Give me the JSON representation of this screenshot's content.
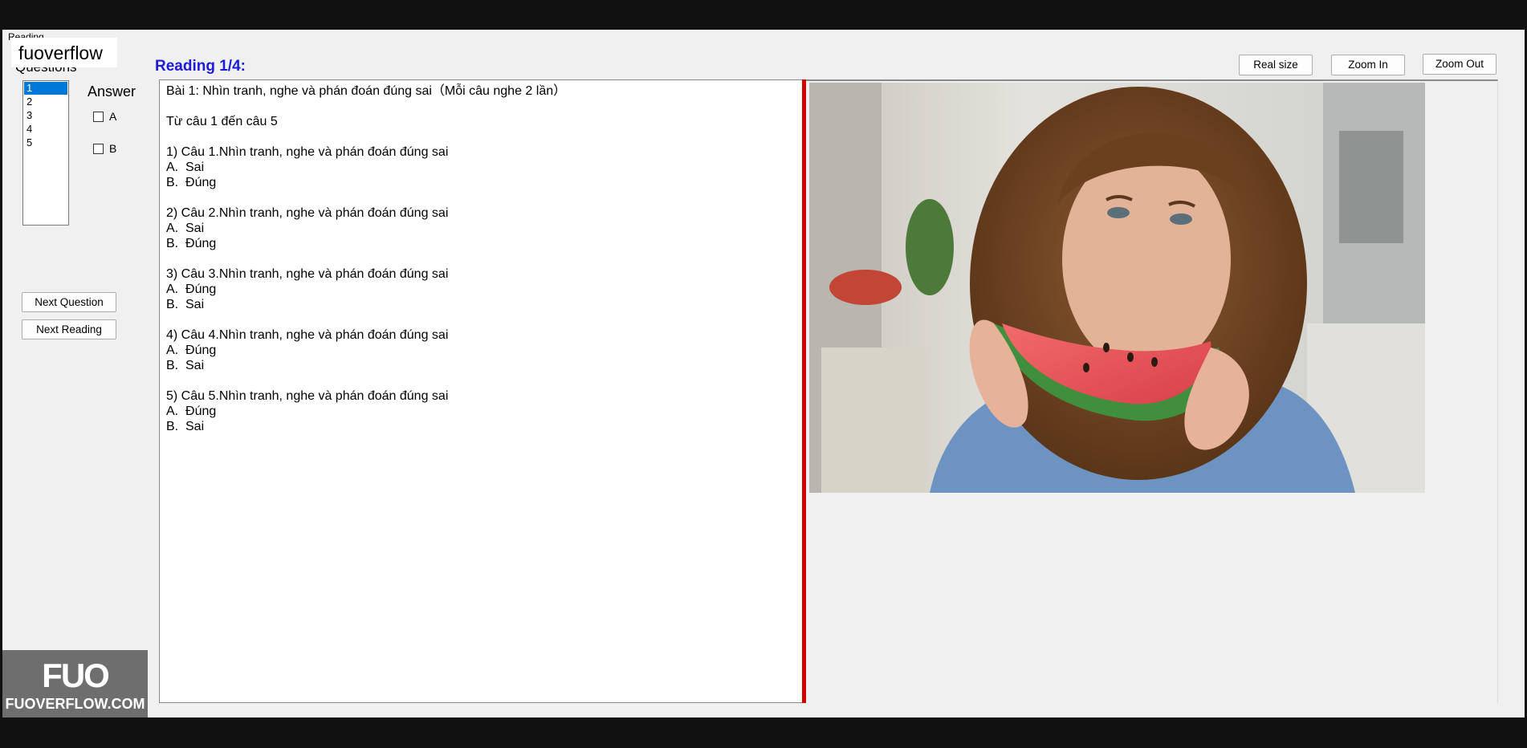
{
  "window": {
    "tab_label": "Reading"
  },
  "watermark": {
    "text": "fuoverflow"
  },
  "questions": {
    "title": "Questions",
    "items": [
      "1",
      "2",
      "3",
      "4",
      "5"
    ],
    "selected_index": 0
  },
  "answer": {
    "label": "Answer",
    "options": [
      "A",
      "B"
    ]
  },
  "buttons": {
    "next_question": "Next Question",
    "next_reading": "Next Reading",
    "real_size": "Real size",
    "zoom_in": "Zoom In",
    "zoom_out": "Zoom Out"
  },
  "reading": {
    "title": "Reading 1/4:",
    "content": "Bài 1: Nhìn tranh, nghe và phán đoán đúng sai（Mỗi câu nghe 2 lần）\n\nTừ câu 1 đến câu 5\n\n1) Câu 1.Nhìn tranh, nghe và phán đoán đúng sai\nA.  Sai\nB.  Đúng\n\n2) Câu 2.Nhìn tranh, nghe và phán đoán đúng sai\nA.  Sai\nB.  Đúng\n\n3) Câu 3.Nhìn tranh, nghe và phán đoán đúng sai\nA.  Đúng\nB.  Sai\n\n4) Câu 4.Nhìn tranh, nghe và phán đoán đúng sai\nA.  Đúng\nB.  Sai\n\n5) Câu 5.Nhìn tranh, nghe và phán đoán đúng sai\nA.  Đúng\nB.  Sai"
  },
  "logo": {
    "mark": "FUO",
    "text": "FUOVERFLOW.COM"
  },
  "colors": {
    "accent_blue": "#1c1cd8",
    "divider_red": "#d40000",
    "selection": "#0078d7"
  }
}
